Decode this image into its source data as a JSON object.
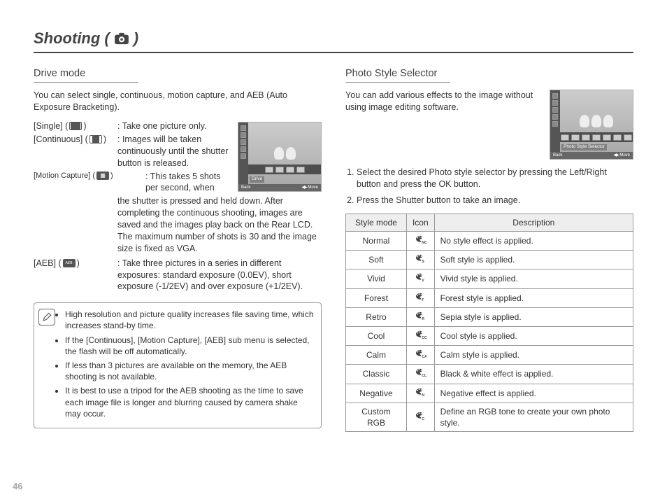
{
  "page_title_prefix": "Shooting (",
  "page_title_suffix": ")",
  "page_number": "46",
  "left": {
    "heading": "Drive mode",
    "intro": "You can select single, continuous, motion capture, and AEB (Auto Exposure Bracketing).",
    "modes": {
      "single_label": "[Single] (",
      "single_label_end": ")",
      "single_desc": ": Take one picture only.",
      "continuous_label": "[Continuous] (",
      "continuous_label_end": ")",
      "continuous_desc": ": Images will be taken continuously until the shutter button is released.",
      "motion_label": "[Motion Capture] (",
      "motion_label_end": ")",
      "motion_desc_a": ": This takes 5 shots per second, when",
      "motion_desc_b": "the shutter is pressed and held down. After completing the continuous shooting, images are saved and the images play back on the Rear LCD. The maximum number of shots is 30 and the image size is fixed as VGA.",
      "aeb_label": "[AEB] (",
      "aeb_label_end": ")",
      "aeb_desc": ": Take three pictures in a series in different exposures: standard exposure (0.0EV), short exposure (-1/2EV) and over exposure (+1/2EV)."
    },
    "screenshot": {
      "title": "Drive",
      "back": "Back",
      "move": "Move"
    },
    "notes": [
      "High resolution and picture quality increases file saving time, which increases stand-by time.",
      "If the [Continuous], [Motion Capture], [AEB] sub menu is selected, the flash will be off automatically.",
      "If less than 3 pictures are available on the memory, the AEB shooting is not available.",
      "It is best to use a tripod for the AEB shooting as the time to save each image file is longer and blurring caused by camera shake may occur."
    ]
  },
  "right": {
    "heading": "Photo Style Selector",
    "intro": "You can add various effects to the image without using image editing software.",
    "screenshot": {
      "title": "Photo Style Selector",
      "back": "Back",
      "move": "Move"
    },
    "steps": [
      "Select the desired Photo style selector by pressing the Left/Right button and press the OK button.",
      "Press the Shutter button to take an image."
    ],
    "table_headers": {
      "mode": "Style mode",
      "icon": "Icon",
      "desc": "Description"
    },
    "rows": [
      {
        "mode": "Normal",
        "icon": "NOR",
        "desc": "No style effect is applied."
      },
      {
        "mode": "Soft",
        "icon": "S",
        "desc": "Soft style is applied."
      },
      {
        "mode": "Vivid",
        "icon": "V",
        "desc": "Vivid style is applied."
      },
      {
        "mode": "Forest",
        "icon": "F",
        "desc": "Forest style is applied."
      },
      {
        "mode": "Retro",
        "icon": "R",
        "desc": "Sepia style is applied."
      },
      {
        "mode": "Cool",
        "icon": "CO",
        "desc": "Cool style is applied."
      },
      {
        "mode": "Calm",
        "icon": "CA",
        "desc": "Calm style is applied."
      },
      {
        "mode": "Classic",
        "icon": "CL",
        "desc": "Black & white effect is applied."
      },
      {
        "mode": "Negative",
        "icon": "N",
        "desc": "Negative effect is applied."
      },
      {
        "mode": "Custom RGB",
        "icon": "C",
        "desc": "Define an RGB tone to create your own photo style."
      }
    ]
  }
}
